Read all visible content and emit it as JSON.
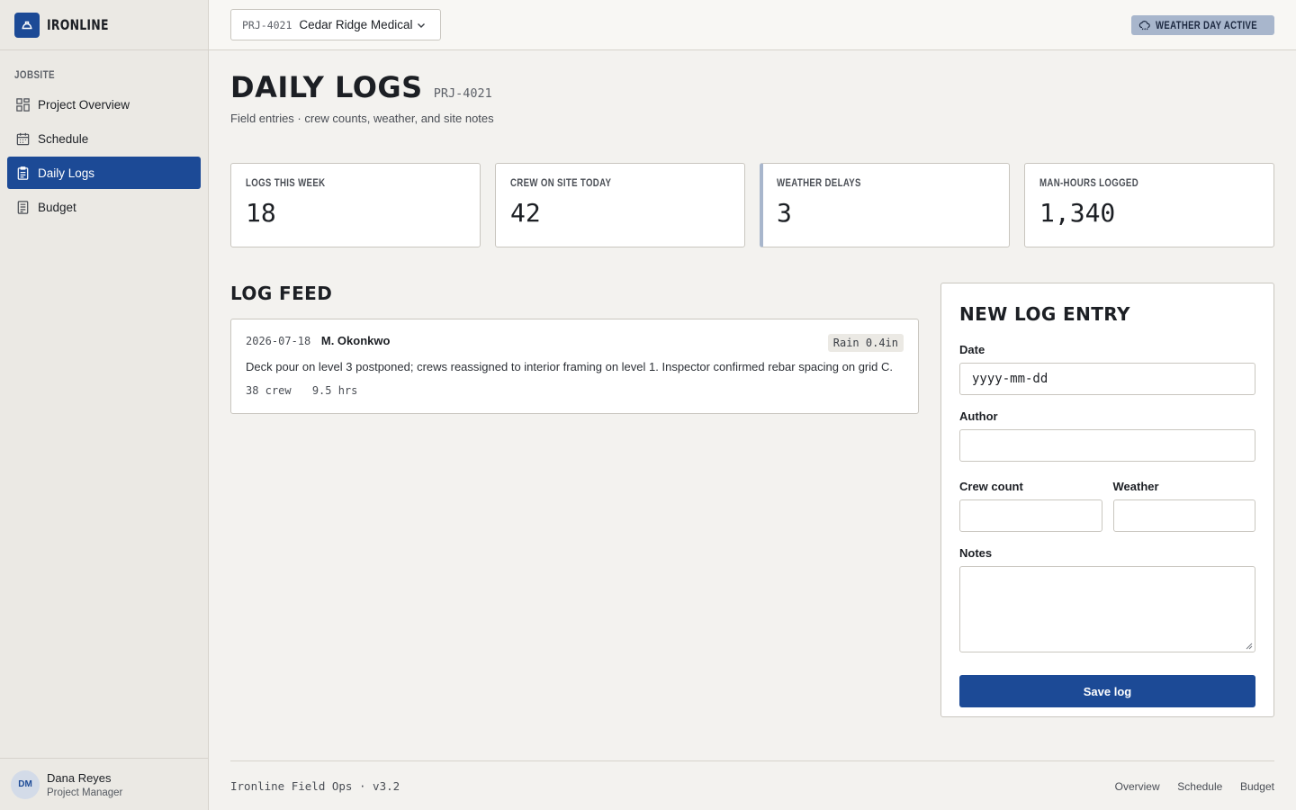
{
  "brand": {
    "name": "IRONLINE"
  },
  "sidebar": {
    "section_label": "JOBSITE",
    "items": [
      {
        "label": "Project Overview",
        "icon": "grid-icon",
        "active": false
      },
      {
        "label": "Schedule",
        "icon": "calendar-icon",
        "active": false
      },
      {
        "label": "Daily Logs",
        "icon": "clipboard-icon",
        "active": true
      },
      {
        "label": "Budget",
        "icon": "receipt-icon",
        "active": false
      }
    ],
    "user": {
      "initials": "DM",
      "name": "Dana Reyes",
      "role": "Project Manager"
    }
  },
  "topbar": {
    "project_code": "PRJ-4021",
    "project_name": "Cedar Ridge Medical",
    "weather_badge": "WEATHER DAY ACTIVE"
  },
  "page": {
    "title": "DAILY LOGS",
    "code": "PRJ-4021",
    "subtitle": "Field entries · crew counts, weather, and site notes"
  },
  "stats": [
    {
      "label": "LOGS THIS WEEK",
      "value": "18"
    },
    {
      "label": "CREW ON SITE TODAY",
      "value": "42"
    },
    {
      "label": "WEATHER DELAYS",
      "value": "3"
    },
    {
      "label": "MAN-HOURS LOGGED",
      "value": "1,340"
    }
  ],
  "feed": {
    "title": "LOG FEED",
    "entries": [
      {
        "date": "2026-07-18",
        "author": "M. Okonkwo",
        "weather": "Rain 0.4in",
        "notes": "Deck pour on level 3 postponed; crews reassigned to interior framing on level 1. Inspector confirmed rebar spacing on grid C.",
        "crew": "38 crew",
        "hours": "9.5 hrs"
      }
    ]
  },
  "form": {
    "title": "NEW LOG ENTRY",
    "date_label": "Date",
    "date_value": "yyyy-mm-dd",
    "author_label": "Author",
    "author_value": "",
    "crew_label": "Crew count",
    "crew_value": "",
    "weather_label": "Weather",
    "weather_value": "",
    "notes_label": "Notes",
    "notes_value": "",
    "save_label": "Save log"
  },
  "footer": {
    "left": "Ironline Field Ops · v3.2",
    "links": [
      "Overview",
      "Schedule",
      "Budget"
    ]
  },
  "colors": {
    "primary": "#1c4a96",
    "badge": "#a8b6cc",
    "background": "#f3f2ef"
  }
}
